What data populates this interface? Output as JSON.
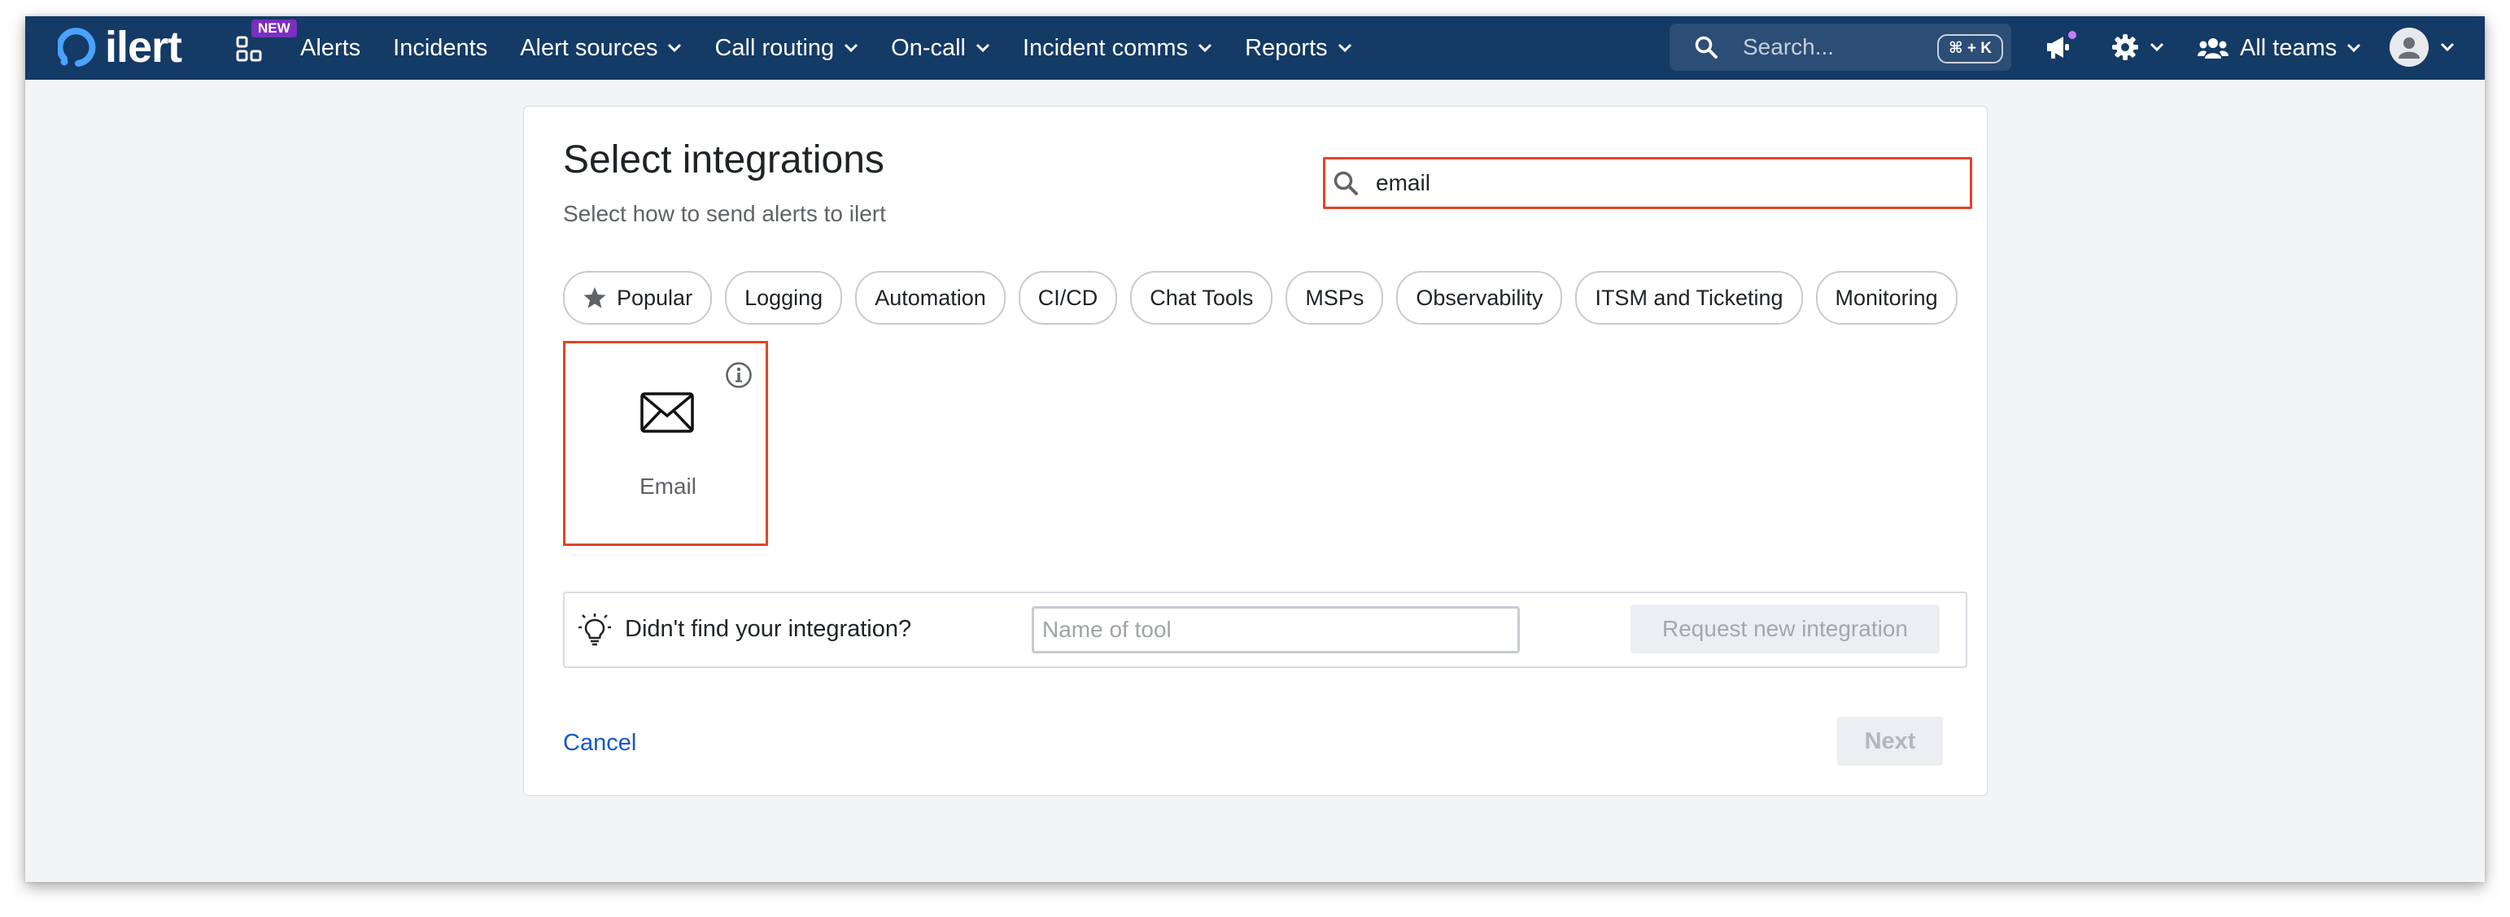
{
  "nav": {
    "logo_text": "ilert",
    "new_badge": "NEW",
    "items": [
      {
        "label": "Alerts",
        "has_chevron": false
      },
      {
        "label": "Incidents",
        "has_chevron": false
      },
      {
        "label": "Alert sources",
        "has_chevron": true
      },
      {
        "label": "Call routing",
        "has_chevron": true
      },
      {
        "label": "On-call",
        "has_chevron": true
      },
      {
        "label": "Incident comms",
        "has_chevron": true
      },
      {
        "label": "Reports",
        "has_chevron": true
      }
    ],
    "search_placeholder": "Search...",
    "search_shortcut": "⌘ + K",
    "teams_label": "All teams",
    "icons": [
      "apps-grid-icon",
      "megaphone-icon",
      "gear-icon",
      "users-icon",
      "avatar-icon",
      "chevron-down-icon"
    ]
  },
  "page": {
    "title": "Select integrations",
    "subtitle": "Select how to send alerts to ilert",
    "search_value": "email",
    "categories": [
      "Popular",
      "Logging",
      "Automation",
      "CI/CD",
      "Chat Tools",
      "MSPs",
      "Observability",
      "ITSM and Ticketing",
      "Monitoring"
    ],
    "results": [
      {
        "label": "Email",
        "icon": "envelope-icon"
      }
    ],
    "request": {
      "question": "Didn't find your integration?",
      "input_placeholder": "Name of tool",
      "button_label": "Request new integration"
    },
    "cancel_label": "Cancel",
    "next_label": "Next"
  },
  "colors": {
    "nav_bg": "#143a66",
    "highlight_border": "#e0452a",
    "link": "#1558c4",
    "badge": "#7b2fbf"
  }
}
